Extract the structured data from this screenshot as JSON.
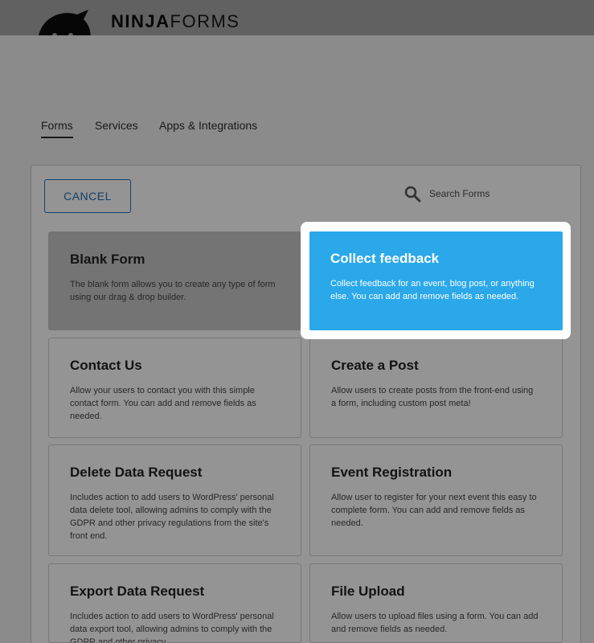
{
  "brand": {
    "bold": "NINJA",
    "light": "FORMS"
  },
  "tabs": [
    {
      "label": "Forms",
      "active": true
    },
    {
      "label": "Services",
      "active": false
    },
    {
      "label": "Apps & Integrations",
      "active": false
    }
  ],
  "cancel_label": "CANCEL",
  "search": {
    "placeholder": "Search Forms",
    "icon": "magnifier-icon"
  },
  "templates": [
    {
      "title": "Blank Form",
      "desc": "The blank form allows you to create any type of form using our drag & drop builder."
    },
    {
      "title": "Collect feedback",
      "desc": "Collect feedback for an event, blog post, or anything else. You can add and remove fields as needed."
    },
    {
      "title": "Contact Us",
      "desc": "Allow your users to contact you with this simple contact form. You can add and remove fields as needed."
    },
    {
      "title": "Create a Post",
      "desc": "Allow users to create posts from the front-end using a form, including custom post meta!"
    },
    {
      "title": "Delete Data Request",
      "desc": "Includes action to add users to WordPress' personal data delete tool, allowing admins to comply with the GDPR and other privacy regulations from the site's front end."
    },
    {
      "title": "Event Registration",
      "desc": "Allow user to register for your next event this easy to complete form. You can add and remove fields as needed."
    },
    {
      "title": "Export Data Request",
      "desc": "Includes action to add users to WordPress' personal data export tool, allowing admins to comply with the GDPR and other privacy"
    },
    {
      "title": "File Upload",
      "desc": "Allow users to upload files using a form. You can add and remove fields as needed."
    }
  ],
  "colors": {
    "accent": "#2271b1",
    "highlight": "#2aa8ea",
    "blank_card": "#c9c9c9"
  }
}
